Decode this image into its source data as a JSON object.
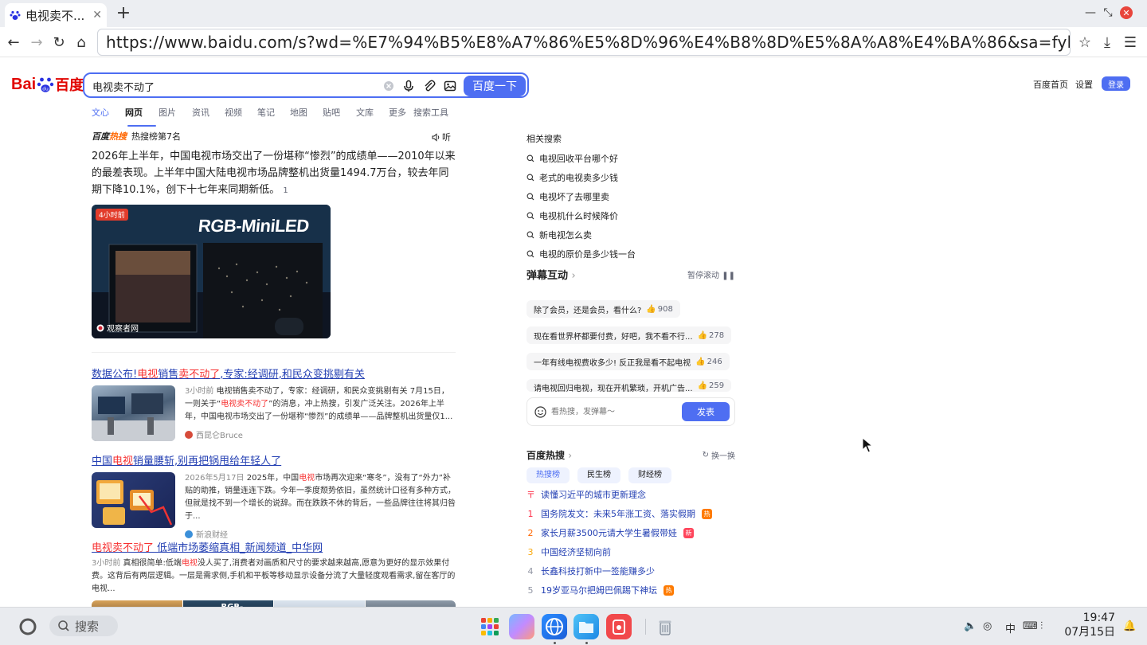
{
  "browser": {
    "tab_title": "电视卖不...",
    "url": "https://www.baidu.com/s?wd=%E7%94%B5%E8%A7%86%E5%8D%96%E4%B8%8D%E5%8A%A8%E4%BA%86&sa=fyb_n_homepage&rsv_dl=fyb_n_homepage"
  },
  "header": {
    "logo_left": "Bai",
    "logo_right": "百度",
    "query": "电视卖不动了",
    "search_button": "百度一下",
    "home_link": "百度首页",
    "settings_link": "设置",
    "login_button": "登录"
  },
  "search_tabs": [
    "文心",
    "网页",
    "图片",
    "资讯",
    "视频",
    "笔记",
    "地图",
    "贴吧",
    "文库",
    "更多",
    "搜索工具"
  ],
  "hot_card": {
    "brand_a": "百度",
    "brand_b": "热搜",
    "rank": "热搜榜第7名",
    "listen": "听",
    "text": "2026年上半年，中国电视市场交出了一份堪称“惨烈”的成绩单——2010年以来的最差表现。上半年中国大陆电视市场品牌整机出货量1494.7万台，较去年同期下降10.1%，创下十七年来同期新低。",
    "ref": "1",
    "image_badge": "4小时前",
    "image_source": "观察者网",
    "image_text": "RGB-MiniLED"
  },
  "results": [
    {
      "title_parts": [
        "数据公布!",
        "电视",
        "销售",
        "卖不动了",
        ",专家:经调研,和民众变挑剔有关"
      ],
      "time": "3小时前",
      "text_a": " 电视销售卖不动了，专家：经调研，和民众变挑剔有关 7月15日，一则关于“",
      "text_em": "电视卖不动了",
      "text_b": "”的消息，冲上热搜，引发广泛关注。2026年上半年，中国电视市场交出了一份堪称“惨烈”的成绩单——品牌整机出货量仅1...",
      "source": "西昆仑Bruce"
    },
    {
      "title_parts": [
        "中国",
        "电视",
        "销量腰斩,别再把锅甩给年轻人了"
      ],
      "time": "2026年5月17日",
      "text_a": " 2025年，中国",
      "text_em": "电视",
      "text_b": "市场再次迎来“寒冬”，没有了“外力”补贴的助推，销量连连下跌。今年一季度颓势依旧，虽然统计口径有多种方式，但就是找不到一个增长的说辞。而在跌跌不休的背后，一些品牌往往将其归咎于...",
      "source": "新浪财经"
    },
    {
      "title_parts": [
        "电视卖不动了",
        " 低端市场萎缩真相_新闻频道_中华网"
      ],
      "time": "3小时前",
      "text_a": " 真相很简单:低端",
      "text_em": "电视",
      "text_b": "没人买了,消费者对画质和尺寸的要求越来越高,愿意为更好的显示效果付费。这背后有两层逻辑。一层是需求侧,手机和平板等移动显示设备分流了大量轻度观看需求,留在客厅的电视..."
    }
  ],
  "related": {
    "title": "相关搜索",
    "items": [
      "电视回收平台哪个好",
      "老式的电视卖多少钱",
      "电视坏了去哪里卖",
      "电视机什么时候降价",
      "新电视怎么卖",
      "电视的原价是多少钱一台"
    ]
  },
  "danmu": {
    "title": "弹幕互动",
    "pause": "暂停滚动",
    "bullets": [
      {
        "text": "除了会员，还是会员，看什么?",
        "likes": "908"
      },
      {
        "text": "现在看世界杯都要付费，好吧，我不看不行...",
        "likes": "278"
      },
      {
        "text": "一年有线电视费收多少! 反正我是看不起电视",
        "likes": "246"
      },
      {
        "text": "请电视回归电视，现在开机繁琐，开机广告...",
        "likes": "259"
      }
    ],
    "placeholder": "看热搜，发弹幕～",
    "send": "发表"
  },
  "hotlist": {
    "title": "百度热搜",
    "refresh": "换一换",
    "tabs": [
      "热搜榜",
      "民生榜",
      "财经榜"
    ],
    "pinned": "读懂习近平的城市更新理念",
    "items": [
      {
        "num": "1",
        "text": "国务院发文：未来5年涨工资、落实假期",
        "tag": "热"
      },
      {
        "num": "2",
        "text": "家长月薪3500元请大学生暑假带娃",
        "tag": "新"
      },
      {
        "num": "3",
        "text": "中国经济坚韧向前",
        "tag": ""
      },
      {
        "num": "4",
        "text": "长鑫科技打新中一签能赚多少",
        "tag": ""
      },
      {
        "num": "5",
        "text": "19岁亚马尔把姆巴佩踢下神坛",
        "tag": "热"
      }
    ]
  },
  "taskbar": {
    "search": "搜索",
    "time": "19:47",
    "date": "07月15日",
    "ime": "中"
  },
  "colors": {
    "brand_blue": "#4e6ef2",
    "link": "#2440b3",
    "highlight": "#f73131",
    "baidu_red": "#e10602"
  }
}
